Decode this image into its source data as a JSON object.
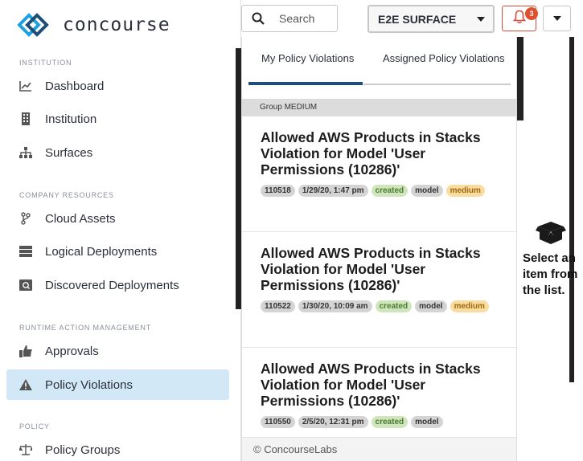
{
  "app": {
    "logo_text": "concourse"
  },
  "sidebar": {
    "sections": [
      {
        "heading": "INSTITUTION"
      },
      {
        "heading": "COMPANY RESOURCES"
      },
      {
        "heading": "RUNTIME ACTION MANAGEMENT"
      },
      {
        "heading": "POLICY"
      }
    ],
    "items": [
      {
        "label": "Dashboard",
        "icon": "chart-line-icon"
      },
      {
        "label": "Institution",
        "icon": "building-icon"
      },
      {
        "label": "Surfaces",
        "icon": "sitemap-icon"
      },
      {
        "label": "Cloud Assets",
        "icon": "branch-icon"
      },
      {
        "label": "Logical Deployments",
        "icon": "server-icon"
      },
      {
        "label": "Discovered Deployments",
        "icon": "search-server-icon"
      },
      {
        "label": "Approvals",
        "icon": "thumbs-up-icon"
      },
      {
        "label": "Policy Violations",
        "icon": "warning-icon",
        "active": true
      },
      {
        "label": "Policy Groups",
        "icon": "balance-scale-icon"
      }
    ]
  },
  "topbar": {
    "search_placeholder": "Search",
    "environment": "E2E SURFACE",
    "notification_count": "3"
  },
  "panel": {
    "tabs": [
      {
        "label": "My Policy Violations",
        "active": true
      },
      {
        "label": "Assigned Policy Violations",
        "active": false
      }
    ],
    "group_label": "Group MEDIUM",
    "cards": [
      {
        "title": "Allowed AWS Products in Stacks Violation for Model 'User Permissions (10286)'",
        "tags": [
          "110518",
          "1/29/20, 1:47 pm",
          "created",
          "model",
          "medium"
        ]
      },
      {
        "title": "Allowed AWS Products in Stacks Violation for Model 'User Permissions (10286)'",
        "tags": [
          "110522",
          "1/30/20, 10:09 am",
          "created",
          "model",
          "medium"
        ]
      },
      {
        "title": "Allowed AWS Products in Stacks Violation for Model 'User Permissions (10286)'",
        "tags": [
          "110550",
          "2/5/20, 12:31 pm",
          "created",
          "model"
        ]
      }
    ],
    "footer": "© ConcourseLabs"
  },
  "detail": {
    "empty_text": "Select an item from the list."
  },
  "colors": {
    "accent": "#1f4e79",
    "active_bg": "#d3e8f6",
    "alert": "#e0502e",
    "created": "#cfe6bd",
    "medium": "#fbdca0"
  }
}
